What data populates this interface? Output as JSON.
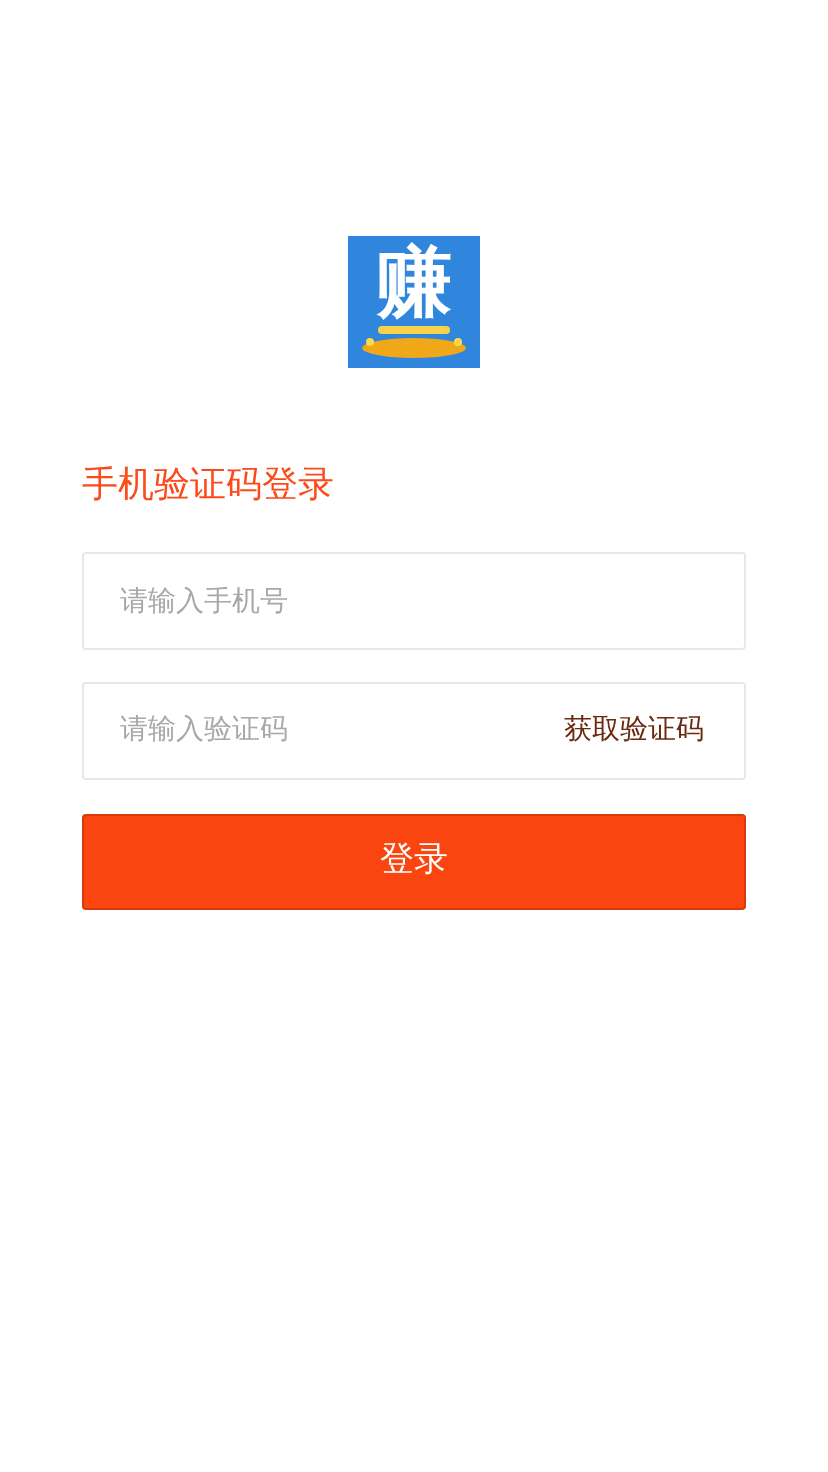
{
  "logo": {
    "text": "赚"
  },
  "title": "手机验证码登录",
  "phone_field": {
    "placeholder": "请输入手机号"
  },
  "code_field": {
    "placeholder": "请输入验证码"
  },
  "get_code_button": "获取验证码",
  "login_button": "登录"
}
